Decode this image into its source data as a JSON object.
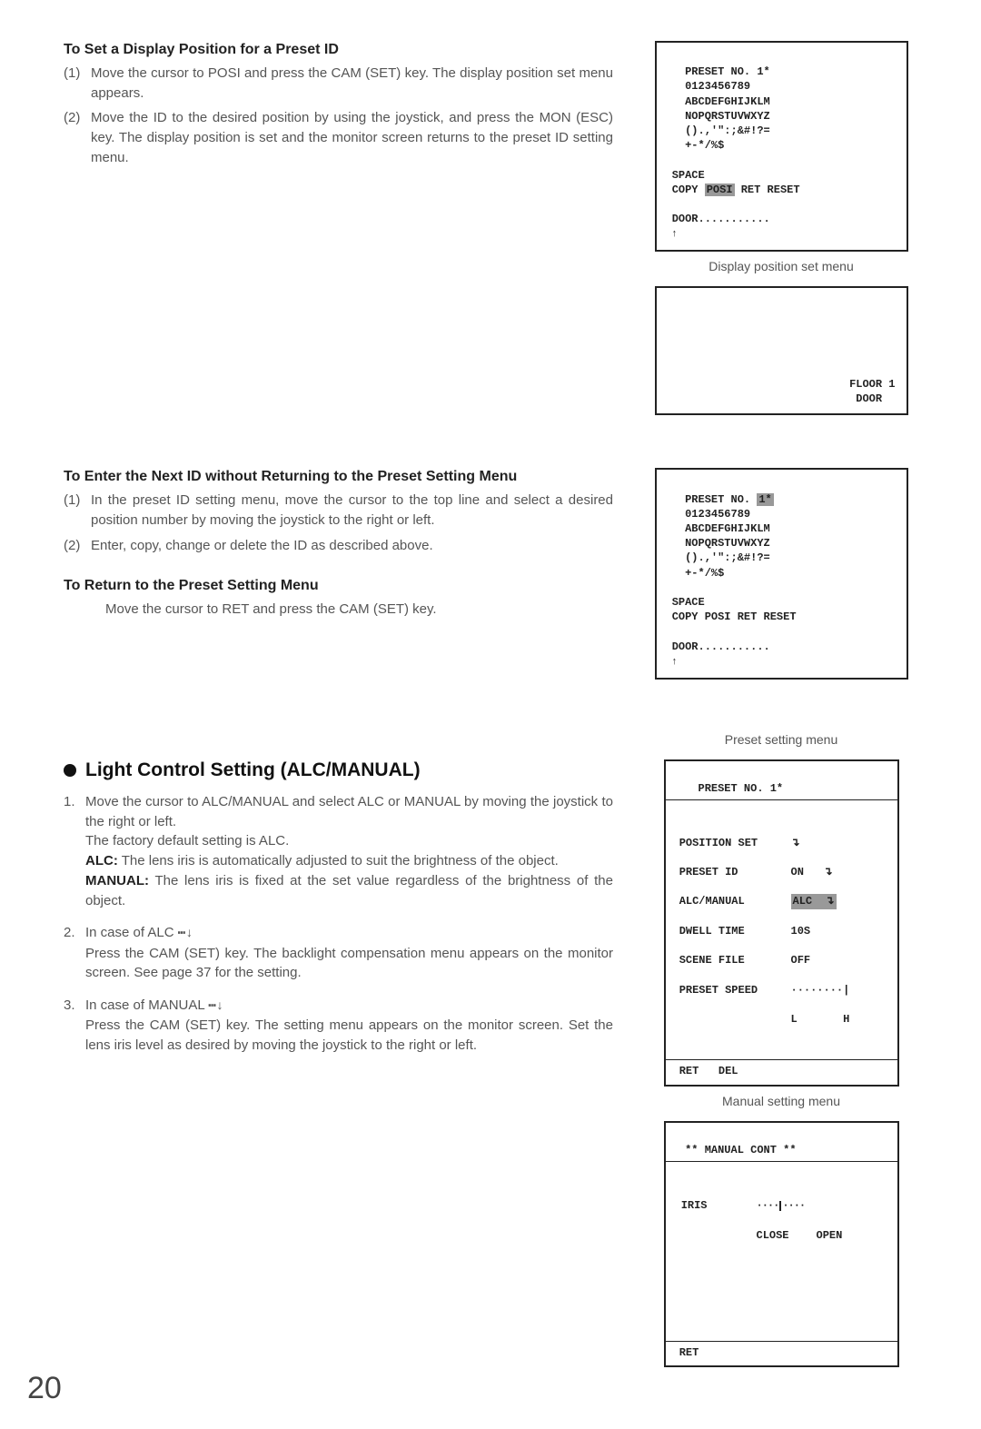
{
  "section1": {
    "heading": "To Set a Display Position for a Preset ID",
    "steps": [
      {
        "num": "(1)",
        "text": "Move the cursor to POSI and press the CAM (SET) key. The display position set menu appears."
      },
      {
        "num": "(2)",
        "text": "Move the ID to the desired position by using the joystick, and press the MON (ESC) key. The display position is set and the monitor screen returns to the preset ID setting menu."
      }
    ]
  },
  "menu1": {
    "l1": "   PRESET NO. 1*",
    "l2": "   0123456789",
    "l3": "   ABCDEFGHIJKLM",
    "l4": "   NOPQRSTUVWXYZ",
    "l5": "   ().,'\":;&#!?=",
    "l6": "   +-*/%$",
    "l7": " SPACE",
    "l8a": " COPY ",
    "l8_posi": "POSI",
    "l8b": " RET RESET",
    "l9": " DOOR...........",
    "arrow": " ↑"
  },
  "caption_display_position": "Display position set menu",
  "menu2": {
    "l1": "FLOOR 1",
    "l2": "DOOR  "
  },
  "section2": {
    "heading": "To Enter the Next ID without Returning to the Preset Setting Menu",
    "steps": [
      {
        "num": "(1)",
        "text": "In the preset ID setting menu, move the cursor to the top line and select a desired position number by moving the joystick to the right or left."
      },
      {
        "num": "(2)",
        "text": "Enter, copy, change or delete the ID as described above."
      }
    ]
  },
  "section3": {
    "heading": "To Return to the Preset Setting Menu",
    "body": "Move the cursor to RET and press the CAM (SET) key."
  },
  "menu3": {
    "l1a": "   PRESET NO. ",
    "l1_hl": "1*",
    "l2": "   0123456789",
    "l3": "   ABCDEFGHIJKLM",
    "l4": "   NOPQRSTUVWXYZ",
    "l5": "   ().,'\":;&#!?=",
    "l6": "   +-*/%$",
    "l7": " SPACE",
    "l8": " COPY POSI RET RESET",
    "l9": " DOOR...........",
    "arrow": " ↑"
  },
  "light_section": {
    "heading": "Light Control Setting (ALC/MANUAL)",
    "items": [
      {
        "num": "1.",
        "body": "Move the cursor to ALC/MANUAL and select ALC or MANUAL by moving the joystick to the right or left.",
        "extra1": "The factory default setting is ALC.",
        "alc_label": "ALC:",
        "alc_text": " The lens iris is automatically adjusted to suit the brightness of the object.",
        "manual_label": "MANUAL:",
        "manual_text": " The lens iris is fixed at the set value regardless of the brightness of the object."
      },
      {
        "num": "2.",
        "lead": "In case of ALC ",
        "sym": "⋯↓",
        "body": "Press the CAM (SET) key. The backlight compensation menu appears on the monitor screen. See page 37 for the setting."
      },
      {
        "num": "3.",
        "lead": "In case of MANUAL ",
        "sym": "⋯↓",
        "body": "Press the CAM (SET) key. The setting menu appears on the monitor screen. Set the lens iris level as desired by moving the joystick to the right or left."
      }
    ]
  },
  "caption_preset": "Preset setting menu",
  "menu_preset": {
    "title": "     PRESET NO. 1*",
    "r1l": " POSITION SET",
    "r1r": "↴",
    "r2l": " PRESET ID",
    "r2r": "ON   ↴",
    "r3l": " ALC/MANUAL",
    "r3_hl": "ALC  ↴",
    "r4l": " DWELL TIME",
    "r4r": "10S",
    "r5l": " SCENE FILE",
    "r5r": "OFF",
    "r6l": " PRESET SPEED",
    "r6r": "········|",
    "r7l": "",
    "r7r": "L       H",
    "foot": " RET   DEL"
  },
  "caption_manual": "Manual setting menu",
  "menu_manual": {
    "title": "   ** MANUAL CONT **",
    "iris_label": " IRIS",
    "meter_left": "····",
    "meter_right": "····",
    "close": "CLOSE",
    "open": "OPEN",
    "foot": " RET"
  },
  "page_number": "20"
}
